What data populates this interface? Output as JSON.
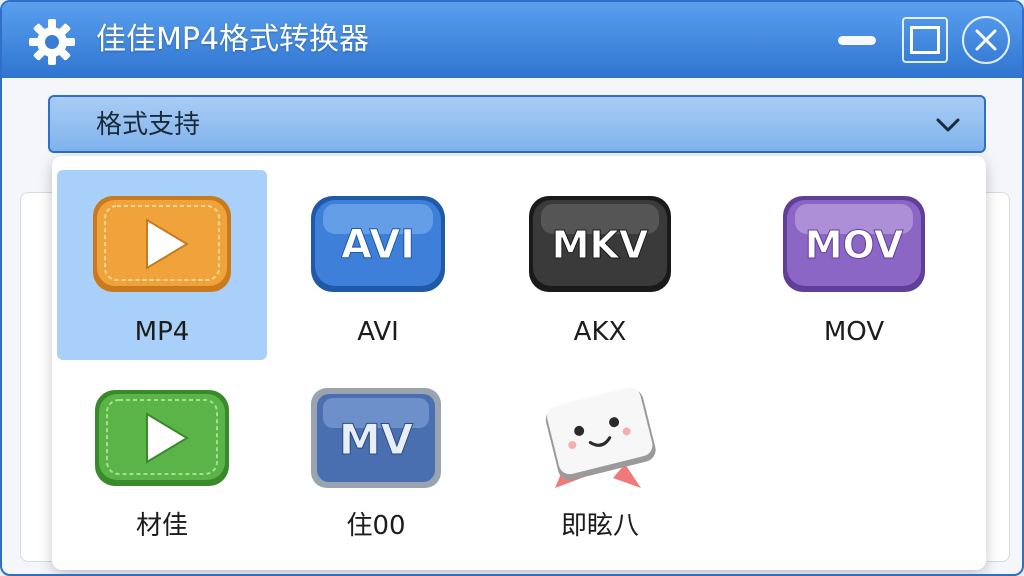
{
  "window": {
    "title": "佳佳MP4格式转换器",
    "icons": {
      "app": "gear-icon",
      "minimize": "minimize-icon",
      "maximize": "maximize-icon",
      "close": "close-icon"
    }
  },
  "dropdown": {
    "selected": "格式支持",
    "icon": "chevron-down-icon"
  },
  "formats": [
    {
      "label": "MP4",
      "badge_text": "",
      "icon": "play-icon",
      "color": "#f0a33a",
      "selected": true
    },
    {
      "label": "AVI",
      "badge_text": "AVI",
      "icon": "avi-icon",
      "color": "#3d7fd9",
      "selected": false
    },
    {
      "label": "AKX",
      "badge_text": "MKV",
      "icon": "mkv-icon",
      "color": "#3a3a3a",
      "selected": false
    },
    {
      "label": "MOV",
      "badge_text": "MOV",
      "icon": "mov-icon",
      "color": "#8c66c4",
      "selected": false
    },
    {
      "label": "材佳",
      "badge_text": "",
      "icon": "play-icon",
      "color": "#5bb447",
      "selected": false
    },
    {
      "label": "住00",
      "badge_text": "MV",
      "icon": "mv-icon",
      "color": "#4a6fb0",
      "selected": false
    },
    {
      "label": "即眩八",
      "badge_text": "",
      "icon": "mascot-icon",
      "color": "#f0f0f0",
      "selected": false
    }
  ]
}
